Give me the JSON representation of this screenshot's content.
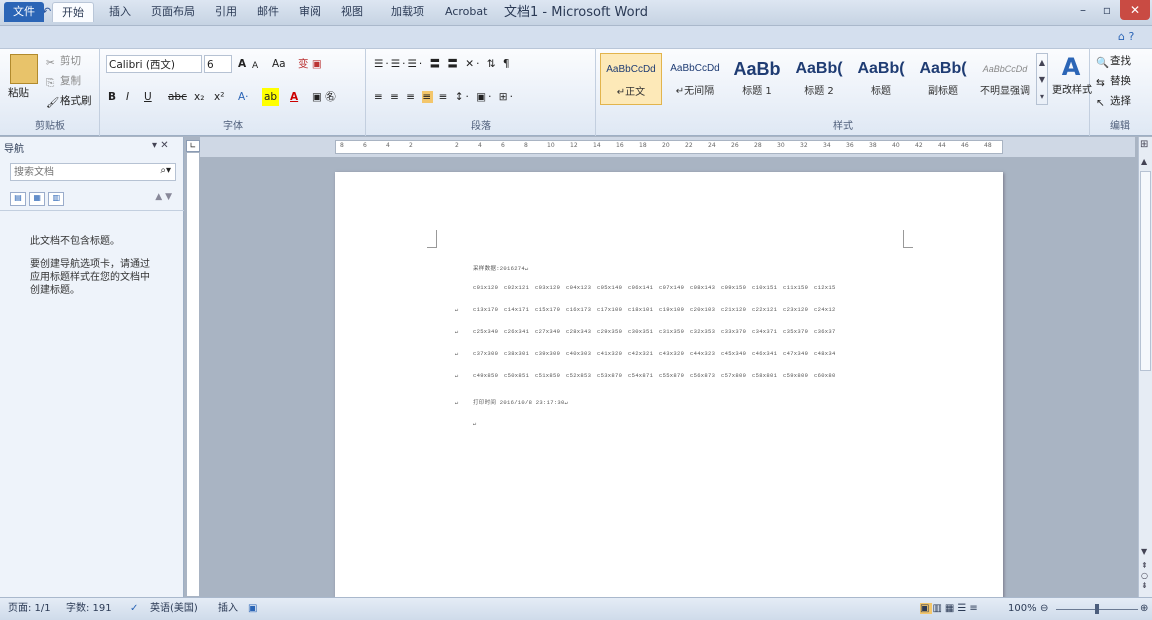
{
  "window": {
    "title": "文档1 - Microsoft Word",
    "minimize": "–",
    "maximize": "▫",
    "close": "✕"
  },
  "qat": {
    "icons": [
      "word-app-icon",
      "save-icon",
      "undo-icon",
      "redo-icon",
      "customize-icon"
    ]
  },
  "tabs": [
    "文件",
    "开始",
    "插入",
    "页面布局",
    "引用",
    "邮件",
    "审阅",
    "视图",
    "加载项",
    "Acrobat"
  ],
  "ribbon": {
    "clipboard": {
      "paste": "粘贴",
      "cut": "剪切",
      "copy": "复制",
      "format_painter": "格式刷",
      "label": "剪贴板"
    },
    "font": {
      "font_name": "Calibri (西文)",
      "font_size": "6",
      "grow": "A",
      "shrink": "A",
      "case": "Aa",
      "bold": "B",
      "italic": "I",
      "underline": "U",
      "strike": "abc",
      "sub": "x₂",
      "sup": "x²",
      "label": "字体"
    },
    "paragraph": {
      "label": "段落"
    },
    "styles": {
      "items": [
        {
          "sample": "AaBbCcDd",
          "name": "↵正文"
        },
        {
          "sample": "AaBbCcDd",
          "name": "↵无间隔"
        },
        {
          "sample": "AaBb",
          "name": "标题 1"
        },
        {
          "sample": "AaBb(",
          "name": "标题 2"
        },
        {
          "sample": "AaBb(",
          "name": "标题"
        },
        {
          "sample": "AaBb(",
          "name": "副标题"
        },
        {
          "sample": "AaBbCcDd",
          "name": "不明显强调"
        }
      ],
      "change": "更改样式",
      "label": "样式"
    },
    "editing": {
      "find": "查找",
      "replace": "替换",
      "select": "选择",
      "label": "编辑"
    }
  },
  "nav": {
    "title": "导航",
    "search_placeholder": "搜索文档",
    "empty_title": "此文档不包含标题。",
    "empty_hint": "要创建导航选项卡，请通过应用标题样式在您的文档中创建标题。"
  },
  "ruler": {
    "ticks": [
      "8",
      "6",
      "4",
      "2",
      "",
      "2",
      "4",
      "6",
      "8",
      "10",
      "12",
      "14",
      "16",
      "18",
      "20",
      "22",
      "24",
      "26",
      "28",
      "30",
      "32",
      "34",
      "36",
      "38",
      "40",
      "42",
      "44",
      "46",
      "48"
    ]
  },
  "document": {
    "header_line": "采样数据:2016274↵",
    "rows": [
      [
        "c01x120",
        "c02x121",
        "c03x129",
        "c04x123",
        "c05x140",
        "c06x141",
        "c07x149",
        "c08x143",
        "c09x150",
        "c10x151",
        "c11x159",
        "c12x15"
      ],
      [
        "c13x170",
        "c14x171",
        "c15x179",
        "c16x173",
        "c17x100",
        "c18x101",
        "c19x109",
        "c20x103",
        "c21x120",
        "c22x121",
        "c23x129",
        "c24x12"
      ],
      [
        "c25x340",
        "c26x341",
        "c27x349",
        "c28x343",
        "c29x350",
        "c30x351",
        "c31x359",
        "c32x353",
        "c33x370",
        "c34x371",
        "c35x379",
        "c36x37"
      ],
      [
        "c37x300",
        "c38x301",
        "c39x309",
        "c40x303",
        "c41x320",
        "c42x321",
        "c43x329",
        "c44x323",
        "c45x340",
        "c46x341",
        "c47x349",
        "c48x34"
      ],
      [
        "c49x850",
        "c50x851",
        "c51x859",
        "c52x853",
        "c53x870",
        "c54x871",
        "c55x879",
        "c56x873",
        "c57x800",
        "c58x801",
        "c59x809",
        "c60x80"
      ]
    ],
    "footer_line": "打印时间 2016/10/8 23:17:30↵",
    "end_mark": "↵"
  },
  "status": {
    "page": "页面: 1/1",
    "words": "字数: 191",
    "language": "英语(美国)",
    "mode": "插入",
    "zoom": "100%",
    "zoom_level": 1.0
  }
}
